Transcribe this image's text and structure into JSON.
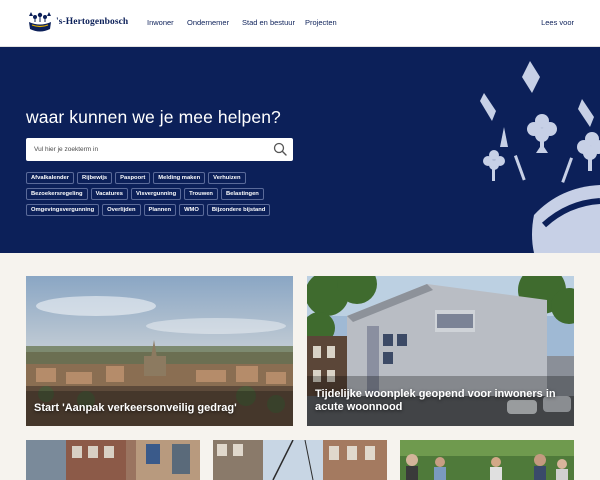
{
  "header": {
    "logo_text": "'s-Hertogenbosch",
    "nav": [
      {
        "label": "Inwoner"
      },
      {
        "label": "Ondernemer"
      },
      {
        "label": "Stad en bestuur"
      },
      {
        "label": "Projecten"
      }
    ],
    "lees_voor": "Lees voor"
  },
  "hero": {
    "title": "waar kunnen we je mee helpen?",
    "search_placeholder": "Vul hier je zoekterm in",
    "tags_row1": [
      "Afvalkalender",
      "Rijbewijs",
      "Paspoort",
      "Melding maken",
      "Verhuizen"
    ],
    "tags_row2": [
      "Bezoekersregeling",
      "Vacatures",
      "Visvergunning",
      "Trouwen",
      "Belastingen"
    ],
    "tags_row3": [
      "Omgevingsvergunning",
      "Overlijden",
      "Plannen",
      "WMO",
      "Bijzondere bijstand"
    ]
  },
  "cards": [
    {
      "title": "Start 'Aanpak verkeersonveilig gedrag'"
    },
    {
      "title": "Tijdelijke woonplek geopend voor inwoners in acute woonnood"
    }
  ],
  "colors": {
    "primary": "#0c2059",
    "background": "#f6f3ee",
    "crown": "#c7d0e6"
  }
}
